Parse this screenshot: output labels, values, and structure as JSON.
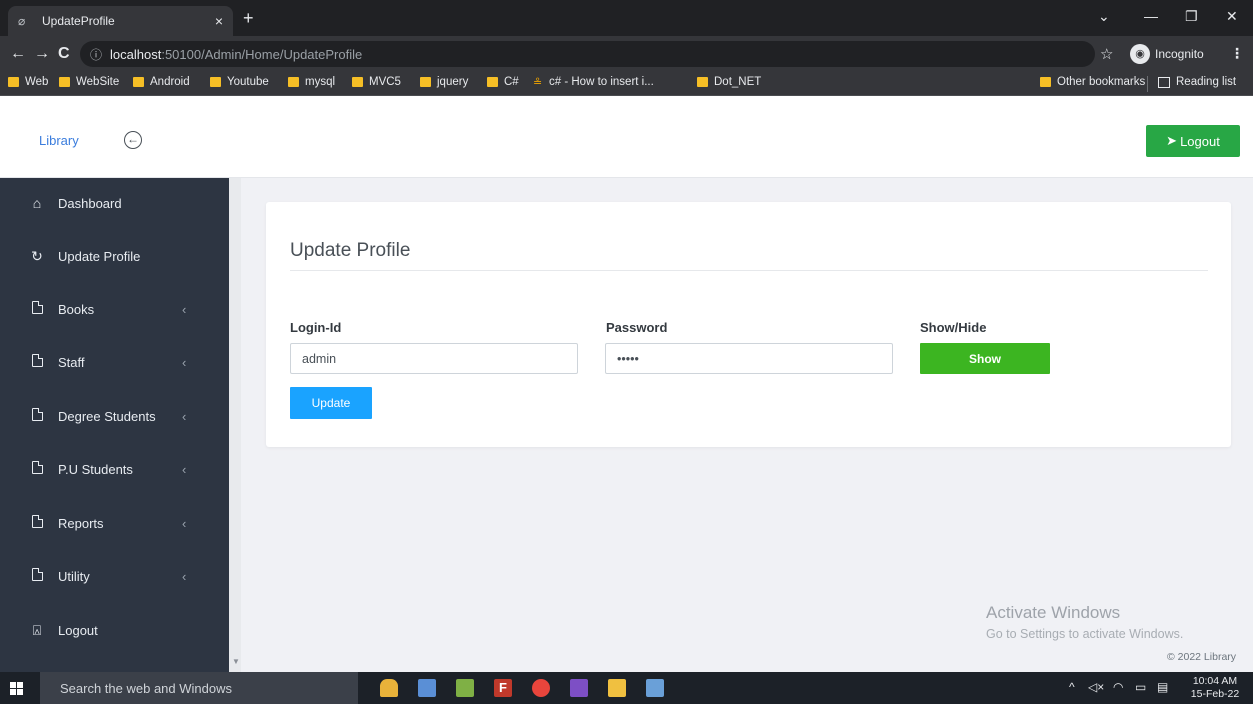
{
  "browser": {
    "tab_title": "UpdateProfile",
    "tab_icon": "globe-icon",
    "url_host": "localhost",
    "url_path": ":50100/Admin/Home/UpdateProfile",
    "incognito_label": "Incognito",
    "bookmarks": [
      "Web",
      "WebSite",
      "Android",
      "Youtube",
      "mysql",
      "MVC5",
      "jquery",
      "C#",
      "c# - How to insert i...",
      "Dot_NET"
    ],
    "other_bookmarks": "Other bookmarks",
    "reading_list": "Reading list"
  },
  "header": {
    "brand": "Library",
    "logout_label": "Logout"
  },
  "sidebar": {
    "items": [
      {
        "label": "Dashboard",
        "icon": "home-icon"
      },
      {
        "label": "Update Profile",
        "icon": "refresh-icon"
      },
      {
        "label": "Books",
        "icon": "document-icon"
      },
      {
        "label": "Staff",
        "icon": "document-icon"
      },
      {
        "label": "Degree Students",
        "icon": "document-icon"
      },
      {
        "label": "P.U Students",
        "icon": "document-icon"
      },
      {
        "label": "Reports",
        "icon": "document-icon"
      },
      {
        "label": "Utility",
        "icon": "document-icon"
      },
      {
        "label": "Logout",
        "icon": "lock-icon"
      }
    ]
  },
  "profile_form": {
    "title": "Update Profile",
    "login_label": "Login-Id",
    "login_value": "admin",
    "password_label": "Password",
    "password_value": "•••••",
    "showhide_label": "Show/Hide",
    "show_button": "Show",
    "update_button": "Update"
  },
  "watermark": {
    "title": "Activate Windows",
    "subtitle": "Go to Settings to activate Windows."
  },
  "footer": {
    "copyright": "© 2022 Library"
  },
  "taskbar": {
    "search_placeholder": "Search the web and Windows",
    "time": "10:04 AM",
    "date": "15-Feb-22"
  },
  "colors": {
    "sidebar_bg": "#2d3542",
    "logout_green": "#28a745",
    "show_green": "#3cb521",
    "update_blue": "#1aa3ff",
    "brand_blue": "#3b7ddd"
  }
}
